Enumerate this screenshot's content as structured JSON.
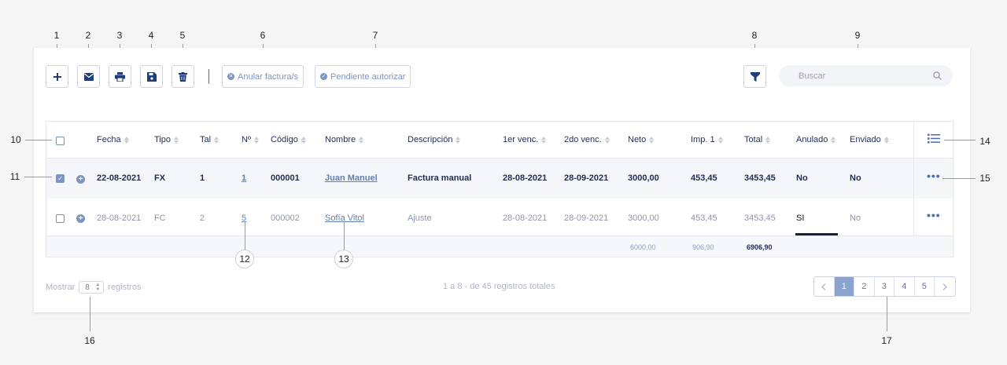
{
  "toolbar": {
    "buttons": [
      {
        "icon": "plus-icon"
      },
      {
        "icon": "mail-icon"
      },
      {
        "icon": "print-icon"
      },
      {
        "icon": "save-icon"
      },
      {
        "icon": "trash-icon"
      }
    ],
    "anular_label": "Anular factura/s",
    "pendiente_label": "Pendiente autorizar",
    "filter_icon": "filter-icon",
    "search_placeholder": "Buscar"
  },
  "table": {
    "headers": [
      "Fecha",
      "Tipo",
      "Tal",
      "Nº",
      "Código",
      "Nombre",
      "Descripción",
      "1er venc.",
      "2do venc.",
      "Neto",
      "Imp. 1",
      "Total",
      "Anulado",
      "Enviado"
    ],
    "rows": [
      {
        "selected": true,
        "fecha": "22-08-2021",
        "tipo": "FX",
        "tal": "1",
        "numero": "1",
        "codigo": "000001",
        "nombre": "Juan Manuel",
        "descripcion": "Factura manual",
        "venc1": "28-08-2021",
        "venc2": "28-09-2021",
        "neto": "3000,00",
        "imp1": "453,45",
        "total": "3453,45",
        "anulado": "No",
        "enviado": "No"
      },
      {
        "selected": false,
        "fecha": "28-08-2021",
        "tipo": "FC",
        "tal": "2",
        "numero": "5",
        "codigo": "000002",
        "nombre": "Sofía Vitol",
        "descripcion": "Ajuste",
        "venc1": "28-08-2021",
        "venc2": "28-09-2021",
        "neto": "3000,00",
        "imp1": "453,45",
        "total": "3453,45",
        "anulado": "SI",
        "enviado": "No"
      }
    ],
    "totals": {
      "neto": "6000,00",
      "imp1": "906,90",
      "total": "6906,90"
    }
  },
  "footer": {
    "mostrar_label": "Mostrar",
    "per_page": "8",
    "registros_label": "registros",
    "range_text": "1 a 8 - de 45 registros totales",
    "pages": [
      "1",
      "2",
      "3",
      "4",
      "5"
    ],
    "current_page": "1"
  },
  "callouts": [
    "1",
    "2",
    "3",
    "4",
    "5",
    "6",
    "7",
    "8",
    "9",
    "10",
    "11",
    "12",
    "13",
    "14",
    "15",
    "16",
    "17"
  ],
  "colors": {
    "accent": "#7c95c4",
    "text": "#1f2d55",
    "active_page": "#8aa4cf"
  }
}
